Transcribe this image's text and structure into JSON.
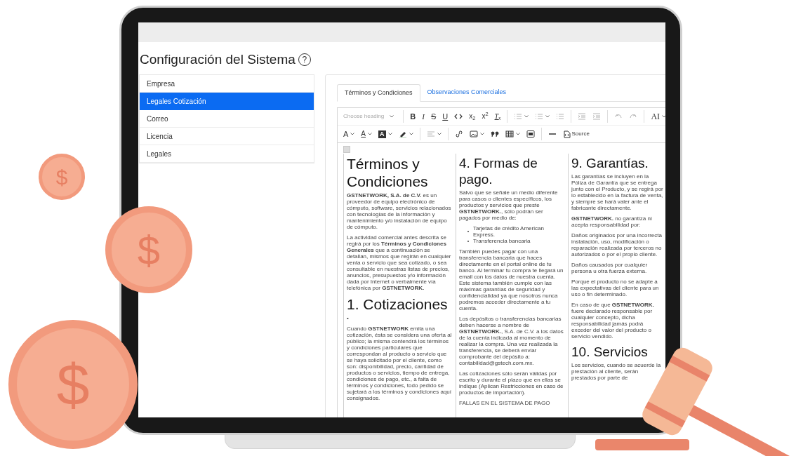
{
  "page_title": "Configuración del Sistema",
  "help_symbol": "?",
  "sidebar": {
    "items": [
      {
        "label": "Empresa",
        "selected": false
      },
      {
        "label": "Legales Cotización",
        "selected": true
      },
      {
        "label": "Correo",
        "selected": false
      },
      {
        "label": "Licencia",
        "selected": false
      },
      {
        "label": "Legales",
        "selected": false
      }
    ]
  },
  "tabs": [
    {
      "label": "Términos y Condiciones",
      "selected": true
    },
    {
      "label": "Observaciones Comerciales",
      "selected": false
    }
  ],
  "toolbar": {
    "heading_select": "Choose heading",
    "bold": "B",
    "italic": "I",
    "strikethrough": "S",
    "underline": "U",
    "subscript": "x$_{2}$",
    "superscript": "x$^{2}$",
    "remove_format": "T$_{x}$",
    "font_family": "AI",
    "font_size": "A",
    "font_color": "A",
    "font_background": "A",
    "source": "Source"
  },
  "document": {
    "columns": [
      {
        "blocks": [
          {
            "kind": "heading",
            "text": "Términos y Condiciones"
          },
          {
            "kind": "paragraph",
            "text": "**GSTNETWORK, S.A. de C.V.** es un proveedor de equipo electrónico de cómputo, software, servicios relacionados con tecnologías de la información y mantenimiento y/o instalación de equipo de cómputo."
          },
          {
            "kind": "paragraph",
            "text": "La actividad comercial antes descrita se regirá por los **Términos y Condiciones Generales** que a continuación se detallan, mismos que regirán en cualquier venta o servicio que sea cotizado, o sea consultable en nuestras listas de precios, anuncios, presupuestos y/o información dada por Internet o verbalmente vía telefónica por **GSTNETWORK.**"
          },
          {
            "kind": "heading",
            "text": "1. Cotizaciones"
          },
          {
            "kind": "paragraph",
            "text": "•"
          },
          {
            "kind": "paragraph",
            "text": "Cuando **GSTNETWORK** emita una cotización, ésta se considera una oferta al público; la misma contendrá los términos y condiciones particulares que correspondan al producto o servicio que se haya solicitado por el cliente, como son: disponibilidad, precio, cantidad de productos o servicios, tiempo de entrega, condiciones de pago, etc., a falta de términos y condiciones, todo pedido se sujetará a los términos y condiciones aquí consignados."
          }
        ]
      },
      {
        "blocks": [
          {
            "kind": "heading",
            "text": "4. Formas de pago."
          },
          {
            "kind": "paragraph",
            "text": "Salvo que se señale un medio diferente para casos o clientes específicos, los productos y servicios que preste **GSTNETWORK.**, sólo podrán ser pagados por medio de:"
          },
          {
            "kind": "list",
            "items": [
              "Tarjetas de crédito American Express.",
              "Transferencia bancaria"
            ]
          },
          {
            "kind": "paragraph",
            "text": "También puedes pagar con una transferencia bancaria que haces directamente en el portal online de tu banco. Al terminar tu compra te llegará un email con los datos de nuestra cuenta. Este sistema también cumple con las máximas garantías de seguridad y confidencialidad ya que nosotros nunca podremos acceder directamente a tu cuenta."
          },
          {
            "kind": "paragraph",
            "text": "Los depósitos o transferencias bancarias deben hacerse a nombre de **GSTNETWORK.**, S.A. de C.V. a los datos de la cuenta indicada al momento de realizar la compra. Una vez realizada la transferencia, se deberá enviar comprobante del depósito a: contabilidad@gstech.com.mx."
          },
          {
            "kind": "paragraph",
            "text": "Las cotizaciones sólo serán válidas por escrito y durante el plazo que en ellas se indique (Aplican Restricciones en caso de productos de importación)."
          },
          {
            "kind": "paragraph",
            "text": "FALLAS EN EL SISTEMA DE PAGO"
          }
        ]
      },
      {
        "blocks": [
          {
            "kind": "heading",
            "text": "9. Garantías."
          },
          {
            "kind": "paragraph",
            "text": "Las garantías se incluyen en la Póliza de Garantía que se entrega junto con el Producto, y se regirá por lo establecido en la factura de venta, y siempre se hará valer ante el fabricante directamente."
          },
          {
            "kind": "paragraph",
            "text": "**GSTNETWORK.** no garantiza ni acepta responsabilidad por:"
          },
          {
            "kind": "paragraph",
            "text": "Daños originados por una incorrecta instalación, uso, modificación o reparación realizada por terceros no autorizados o por el propio cliente."
          },
          {
            "kind": "paragraph",
            "text": "Daños causados por cualquier persona u otra fuerza externa."
          },
          {
            "kind": "paragraph",
            "text": "Porque el producto no se adapte a las expectativas del cliente para un uso o fin determinado."
          },
          {
            "kind": "paragraph",
            "text": "En caso de que **GSTNETWORK.** fuere declarado responsable por cualquier concepto, dicha responsabilidad jamás podrá exceder del valor del producto o servicio vendido."
          },
          {
            "kind": "heading",
            "text": "10. Servicios"
          },
          {
            "kind": "paragraph",
            "text": "Los servicios, cuando se acuerde la prestación al cliente, serán prestados por parte de"
          }
        ]
      }
    ]
  },
  "coins": [
    {
      "symbol": "$"
    },
    {
      "symbol": "$"
    },
    {
      "symbol": "$"
    }
  ]
}
